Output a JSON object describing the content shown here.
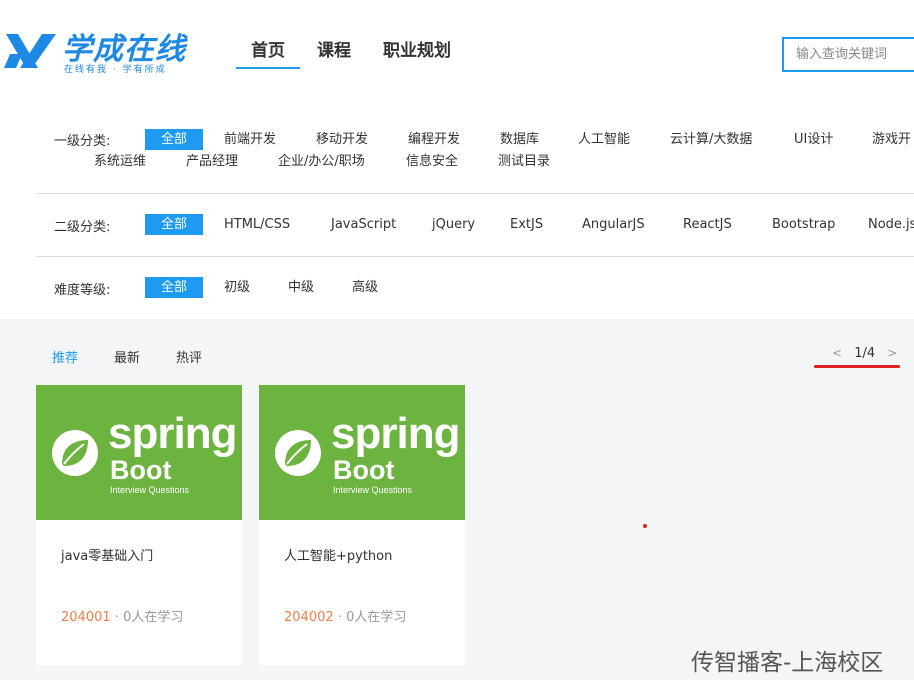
{
  "logo": {
    "title": "学成在线",
    "subtitle": "在线有我 · 学有所成"
  },
  "nav": [
    {
      "label": "首页",
      "active": true
    },
    {
      "label": "课程",
      "active": false
    },
    {
      "label": "职业规划",
      "active": false
    }
  ],
  "search": {
    "placeholder": "输入查询关键词",
    "value": ""
  },
  "filters": {
    "level1": {
      "label": "一级分类:",
      "items": [
        "全部",
        "前端开发",
        "移动开发",
        "编程开发",
        "数据库",
        "人工智能",
        "云计算/大数据",
        "UI设计",
        "游戏开",
        "系统运维",
        "产品经理",
        "企业/办公/职场",
        "信息安全",
        "测试目录"
      ],
      "selected": "全部"
    },
    "level2": {
      "label": "二级分类:",
      "items": [
        "全部",
        "HTML/CSS",
        "JavaScript",
        "jQuery",
        "ExtJS",
        "AngularJS",
        "ReactJS",
        "Bootstrap",
        "Node.js"
      ],
      "selected": "全部"
    },
    "difficulty": {
      "label": "难度等级:",
      "items": [
        "全部",
        "初级",
        "中级",
        "高级"
      ],
      "selected": "全部"
    }
  },
  "sort": {
    "tabs": [
      "推荐",
      "最新",
      "热评"
    ],
    "active": "推荐"
  },
  "pager": {
    "prev": "<",
    "text": "1/4",
    "next": ">"
  },
  "courses": [
    {
      "cover": {
        "word": "spring",
        "sub_word": "Boot",
        "caption": "Interview Questions"
      },
      "title": "java零基础入门",
      "id": "204001",
      "separator": "·",
      "learners": "0人在学习"
    },
    {
      "cover": {
        "word": "spring",
        "sub_word": "Boot",
        "caption": "Interview Questions"
      },
      "title": "人工智能+python",
      "id": "204002",
      "separator": "·",
      "learners": "0人在学习"
    }
  ],
  "watermark": "传智播客-上海校区",
  "colors": {
    "accent": "#1e9bf0",
    "cover_green": "#6db33f",
    "id_orange": "#f07f4c",
    "annotation_red": "#e02020"
  }
}
